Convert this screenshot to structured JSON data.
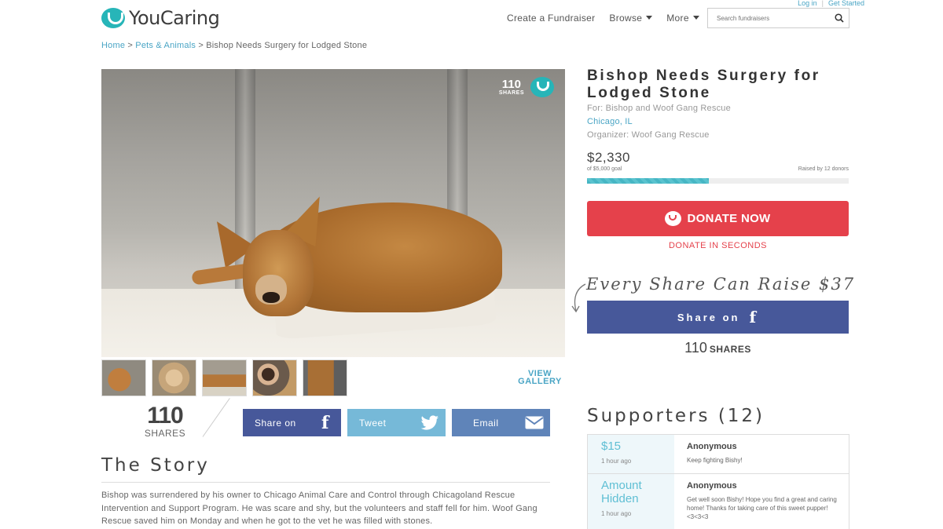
{
  "header": {
    "login": "Log in",
    "get_started": "Get Started",
    "logo_text": "YouCaring",
    "nav": {
      "create": "Create a Fundraiser",
      "browse": "Browse",
      "more": "More"
    },
    "search_placeholder": "Search fundraisers"
  },
  "breadcrumb": {
    "home": "Home",
    "category": "Pets & Animals",
    "current": "Bishop Needs Surgery for Lodged Stone"
  },
  "hero": {
    "share_count": "110",
    "share_label": "SHARES"
  },
  "gallery": {
    "view_label_1": "VIEW",
    "view_label_2": "GALLERY"
  },
  "share_row": {
    "count": "110",
    "label": "SHARES",
    "facebook": "Share on",
    "twitter": "Tweet",
    "email": "Email"
  },
  "story": {
    "title": "The Story",
    "text": "Bishop was surrendered by his owner to Chicago Animal Care and Control through Chicagoland Rescue Intervention and Support Program. He was scare and shy, but the volunteers and staff fell for him. Woof Gang Rescue saved him on Monday and when he got to the vet he was filled with stones."
  },
  "campaign": {
    "title": "Bishop Needs Surgery for Lodged Stone",
    "for": "For: Bishop and Woof Gang Rescue",
    "location": "Chicago, IL",
    "organizer": "Organizer: Woof Gang Rescue",
    "raised": "$2,330",
    "goal": "of $5,000 goal",
    "donors": "Raised by 12 donors",
    "progress_fraction": 0.466
  },
  "donate": {
    "label": "DONATE NOW",
    "sub": "DONATE IN SECONDS"
  },
  "promo": {
    "every_share": "Every Share Can Raise $37",
    "share_on": "Share on",
    "shares_count": "110",
    "shares_label": "SHARES"
  },
  "supporters": {
    "title": "Supporters (12)",
    "items": [
      {
        "amount": "$15",
        "time": "1 hour ago",
        "name": "Anonymous",
        "message": "Keep fighting Bishy!"
      },
      {
        "amount": "Amount Hidden",
        "time": "1 hour ago",
        "name": "Anonymous",
        "message": "Get well soon Bishy! Hope you find a great and caring home! Thanks for taking care of this sweet pupper! <3<3<3"
      }
    ]
  },
  "colors": {
    "accent": "#27b5b8",
    "donate": "#e5414b",
    "facebook": "#47589a",
    "twitter": "#76b9d8",
    "email": "#5f84b9",
    "link": "#4aa5c5"
  },
  "icons": [
    "search-icon",
    "caret-down-icon",
    "youcaring-logo-icon",
    "facebook-icon",
    "twitter-icon",
    "email-icon",
    "curved-arrow-icon",
    "heart-icon"
  ]
}
